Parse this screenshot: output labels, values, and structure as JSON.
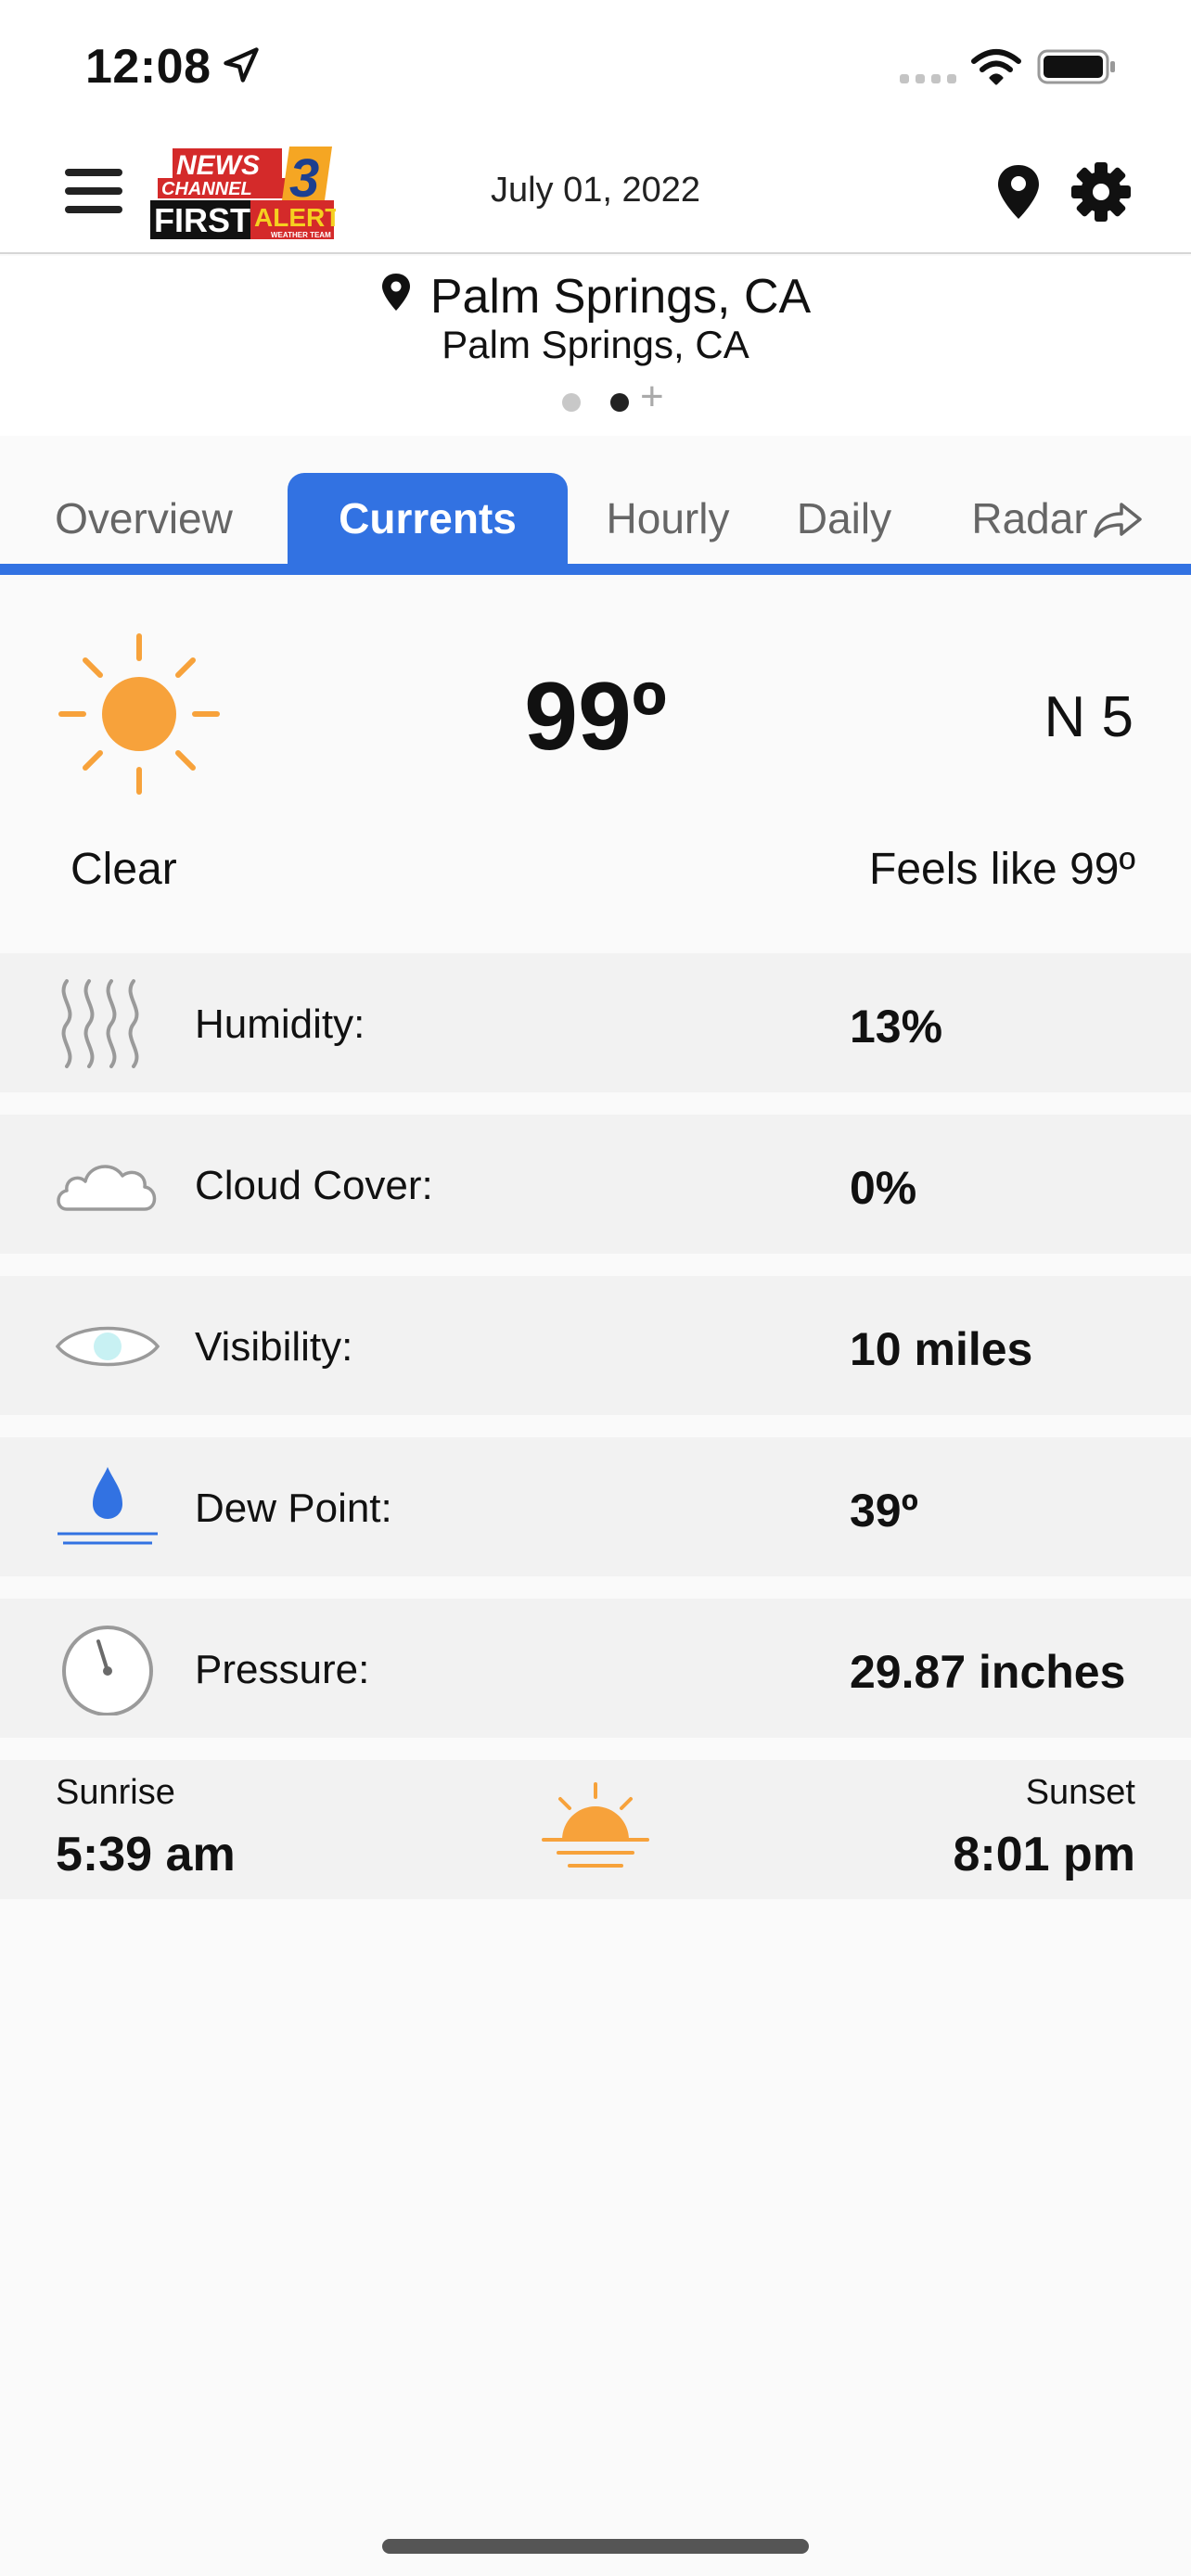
{
  "status_bar": {
    "time": "12:08"
  },
  "header": {
    "date": "July 01, 2022",
    "logo": {
      "line1": "NEWS",
      "line2": "CHANNEL",
      "number": "3",
      "line3": "FIRST",
      "line4": "ALERT",
      "tagline": "WEATHER TEAM"
    }
  },
  "location": {
    "city": "Palm Springs, CA",
    "subtitle": "Palm Springs, CA",
    "pages": 2,
    "active_page": 2
  },
  "tabs": [
    {
      "label": "Overview",
      "active": false
    },
    {
      "label": "Currents",
      "active": true
    },
    {
      "label": "Hourly",
      "active": false
    },
    {
      "label": "Daily",
      "active": false
    },
    {
      "label": "Radar",
      "active": false
    }
  ],
  "current": {
    "temperature": "99º",
    "wind": "N 5",
    "condition": "Clear",
    "feels_like": "Feels like 99º"
  },
  "details": [
    {
      "label": "Humidity:",
      "value": "13%",
      "icon": "humidity-icon"
    },
    {
      "label": "Cloud Cover:",
      "value": "0%",
      "icon": "cloud-icon"
    },
    {
      "label": "Visibility:",
      "value": "10 miles",
      "icon": "eye-icon"
    },
    {
      "label": "Dew Point:",
      "value": "39º",
      "icon": "dew-drop-icon"
    },
    {
      "label": "Pressure:",
      "value": "29.87 inches",
      "icon": "gauge-icon"
    }
  ],
  "sun": {
    "sunrise_label": "Sunrise",
    "sunrise_value": "5:39 am",
    "sunset_label": "Sunset",
    "sunset_value": "8:01 pm"
  },
  "colors": {
    "accent": "#3272e2",
    "sun": "#f7a23b",
    "row_background": "#f2f2f2",
    "logo_red": "#d42a2a",
    "logo_orange": "#f5a623"
  }
}
